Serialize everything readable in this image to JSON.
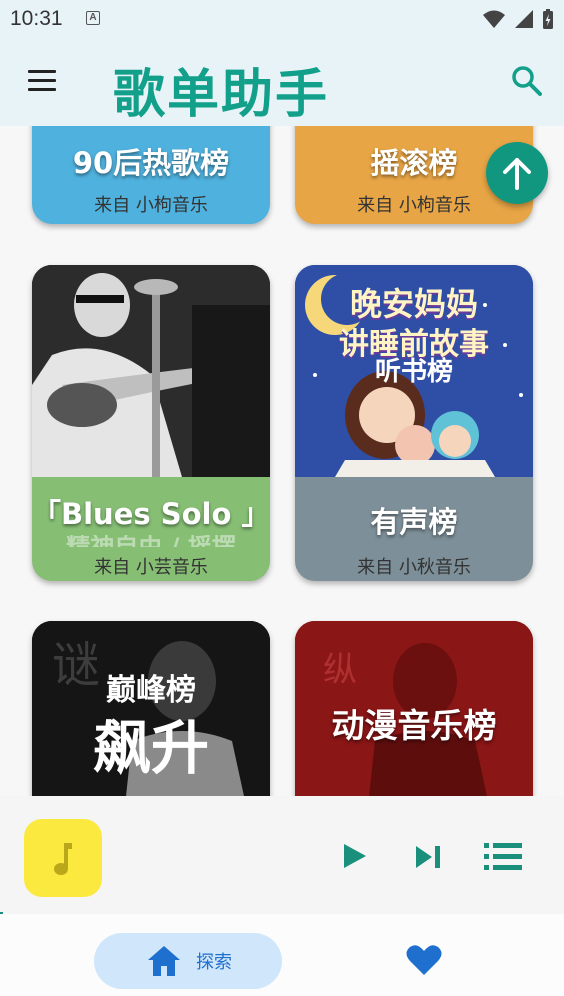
{
  "status_bar": {
    "time": "10:31",
    "notification_letter": "A"
  },
  "app_bar": {
    "title": "歌单助手",
    "menu_icon": "menu-icon",
    "search_icon": "search-icon"
  },
  "playlists": [
    {
      "title": "90后热歌榜",
      "source": "来自 小枸音乐",
      "color": "#4fb1dd"
    },
    {
      "title": "摇滚榜",
      "source": "来自 小枸音乐",
      "color": "#e7a545"
    },
    {
      "title": "「Blues Solo 」",
      "subtitle": "精神自由 / 摇摆",
      "source": "来自 小芸音乐",
      "color": "#86be74",
      "cover_icon": "guitarist-photo"
    },
    {
      "title": "有声榜",
      "source": "来自 小秋音乐",
      "color": "#7d8f98",
      "cover_text": [
        "晚安妈妈",
        "讲睡前故事",
        "听书榜"
      ],
      "cover_icon": "bedtime-story-illustration"
    },
    {
      "title": "",
      "source": "",
      "color": "#1a1a1a",
      "cover_text": [
        "巅峰榜",
        "飙升"
      ],
      "cover_icon": "singer-portrait"
    },
    {
      "title": "",
      "source": "",
      "color": "#8f1818",
      "cover_text": [
        "动漫音乐榜"
      ],
      "cover_icon": "singer-portrait-red"
    }
  ],
  "fab": {
    "icon": "arrow-up-icon",
    "color": "#11967f"
  },
  "player": {
    "art_icon": "music-note-icon",
    "art_color": "#fbe940",
    "play_icon": "play-icon",
    "next_icon": "skip-next-icon",
    "queue_icon": "queue-list-icon",
    "accent": "#1a8f7c"
  },
  "bottom_nav": {
    "explore_label": "探索",
    "explore_icon": "home-icon",
    "favorites_icon": "heart-icon",
    "accent": "#1f6fcf"
  }
}
